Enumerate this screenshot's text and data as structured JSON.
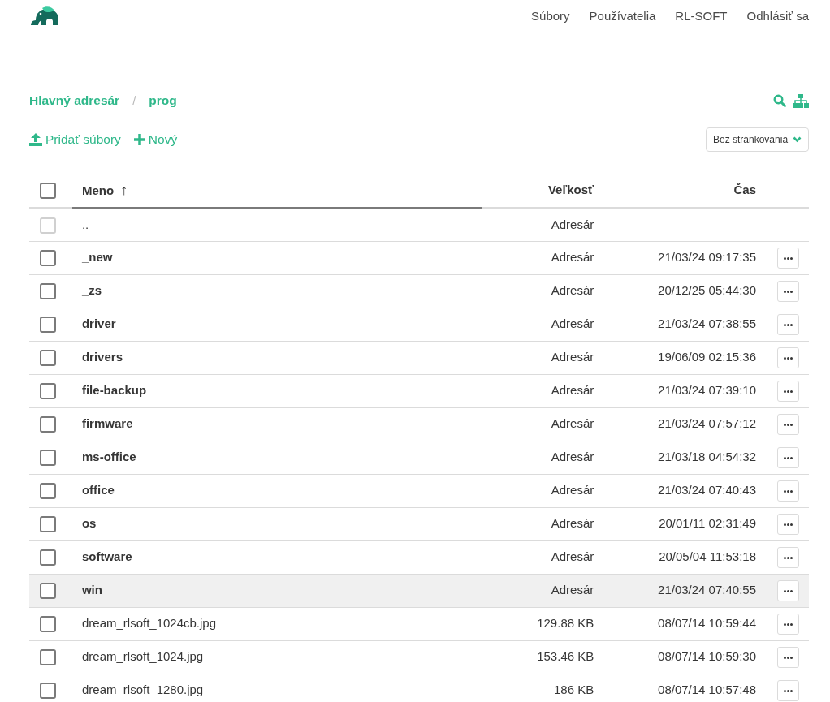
{
  "nav": {
    "links": [
      "Súbory",
      "Používatelia",
      "RL-SOFT",
      "Odhlásiť sa"
    ]
  },
  "breadcrumb": {
    "items": [
      "Hlavný adresár",
      "prog"
    ],
    "separator": "/"
  },
  "toolbar": {
    "upload": "Pridať súbory",
    "new": "Nový",
    "pagination": "Bez stránkovania"
  },
  "table": {
    "columns": [
      {
        "label": "Meno",
        "sorted": true,
        "sort_icon": "↑"
      },
      {
        "label": "Veľkosť",
        "sorted": false
      },
      {
        "label": "Čas",
        "sorted": false
      }
    ],
    "header_checked": false,
    "rows": [
      {
        "kind": "parent",
        "name": "..",
        "size": "Adresár",
        "checked": false,
        "disabled": true,
        "hovered": false
      },
      {
        "kind": "dir",
        "name": "_new",
        "size": "Adresár",
        "time": "21/03/24 09:17:35",
        "checked": false,
        "disabled": false,
        "hovered": false
      },
      {
        "kind": "dir",
        "name": "_zs",
        "size": "Adresár",
        "time": "20/12/25 05:44:30",
        "checked": false,
        "disabled": false,
        "hovered": false
      },
      {
        "kind": "dir",
        "name": "driver",
        "size": "Adresár",
        "time": "21/03/24 07:38:55",
        "checked": false,
        "disabled": false,
        "hovered": false
      },
      {
        "kind": "dir",
        "name": "drivers",
        "size": "Adresár",
        "time": "19/06/09 02:15:36",
        "checked": false,
        "disabled": false,
        "hovered": false
      },
      {
        "kind": "dir",
        "name": "file-backup",
        "size": "Adresár",
        "time": "21/03/24 07:39:10",
        "checked": false,
        "disabled": false,
        "hovered": false
      },
      {
        "kind": "dir",
        "name": "firmware",
        "size": "Adresár",
        "time": "21/03/24 07:57:12",
        "checked": false,
        "disabled": false,
        "hovered": false
      },
      {
        "kind": "dir",
        "name": "ms-office",
        "size": "Adresár",
        "time": "21/03/18 04:54:32",
        "checked": false,
        "disabled": false,
        "hovered": false
      },
      {
        "kind": "dir",
        "name": "office",
        "size": "Adresár",
        "time": "21/03/24 07:40:43",
        "checked": false,
        "disabled": false,
        "hovered": false
      },
      {
        "kind": "dir",
        "name": "os",
        "size": "Adresár",
        "time": "20/01/11 02:31:49",
        "checked": false,
        "disabled": false,
        "hovered": false
      },
      {
        "kind": "dir",
        "name": "software",
        "size": "Adresár",
        "time": "20/05/04 11:53:18",
        "checked": false,
        "disabled": false,
        "hovered": false
      },
      {
        "kind": "dir",
        "name": "win",
        "size": "Adresár",
        "time": "21/03/24 07:40:55",
        "checked": false,
        "disabled": false,
        "hovered": true
      },
      {
        "kind": "file",
        "name": "dream_rlsoft_1024cb.jpg",
        "size": "129.88 KB",
        "time": "08/07/14 10:59:44",
        "checked": false,
        "disabled": false,
        "hovered": false
      },
      {
        "kind": "file",
        "name": "dream_rlsoft_1024.jpg",
        "size": "153.46 KB",
        "time": "08/07/14 10:59:30",
        "checked": false,
        "disabled": false,
        "hovered": false
      },
      {
        "kind": "file",
        "name": "dream_rlsoft_1280.jpg",
        "size": "186 KB",
        "time": "08/07/14 10:57:48",
        "checked": false,
        "disabled": false,
        "hovered": false
      }
    ]
  }
}
